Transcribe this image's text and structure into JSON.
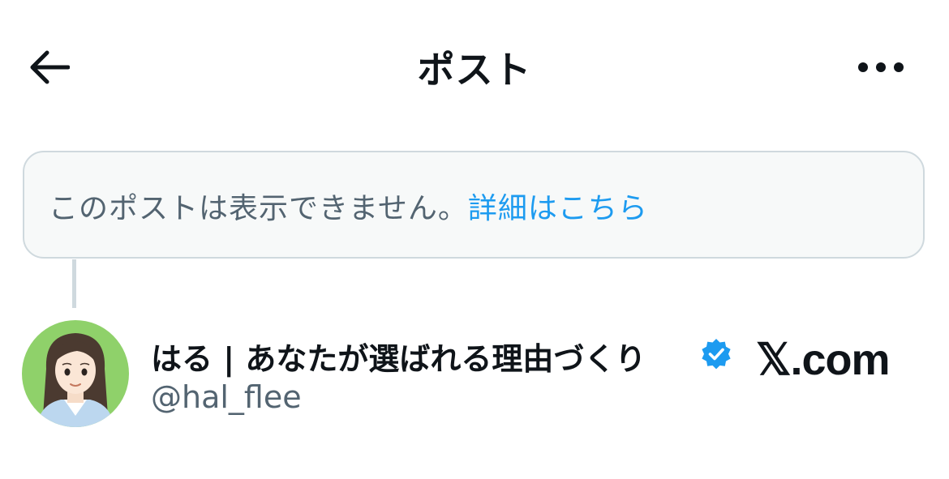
{
  "header": {
    "title": "ポスト",
    "back_icon": "arrow-left-icon",
    "more_icon": "more-horizontal-icon"
  },
  "notice": {
    "text": "このポストは表示できません。",
    "link_label": "詳細はこちら"
  },
  "author": {
    "display_name": "はる | あなたが選ばれる理由づくり",
    "handle": "@hal_flee",
    "verified": true,
    "badge_icon": "verified-badge-icon",
    "avatar_icon": "avatar-illustration"
  },
  "watermark": {
    "text": "𝕏.com"
  },
  "colors": {
    "text_primary": "#0f1419",
    "text_secondary": "#536471",
    "link": "#1d9bf0",
    "border": "#cfd9de",
    "notice_background": "#f7f9f9",
    "avatar_background": "#8fd16a"
  }
}
